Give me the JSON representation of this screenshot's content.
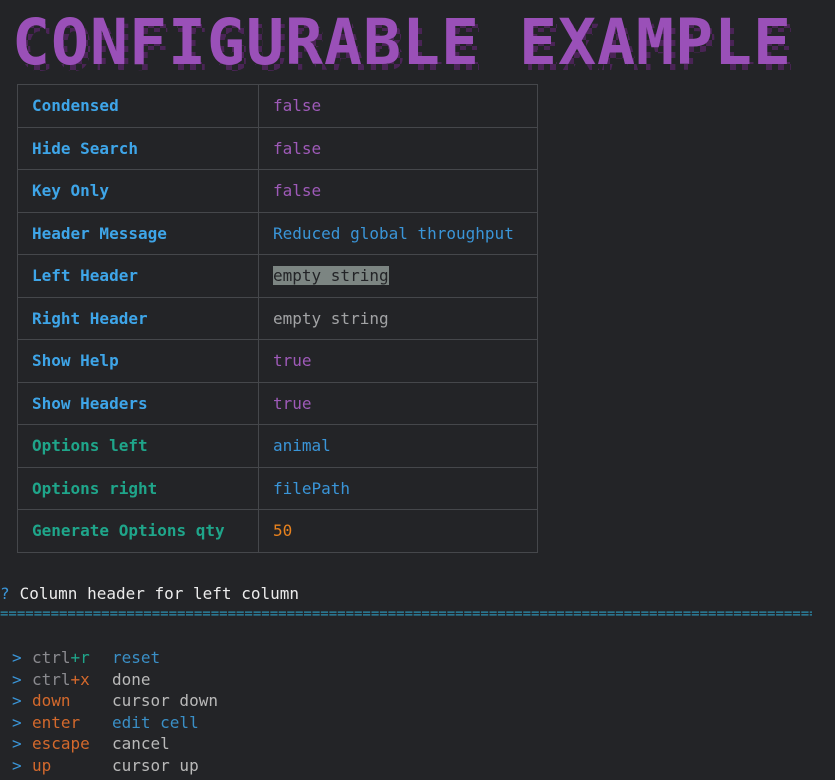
{
  "banner": {
    "title": "CONFIGURABLE EXAMPLE",
    "color": "#9a50b8",
    "shadow_color": "#53285f"
  },
  "config": {
    "rows": [
      {
        "key": "Condensed",
        "value": "false",
        "key_style": "key-blue",
        "value_style": "v-purple"
      },
      {
        "key": "Hide Search",
        "value": "false",
        "key_style": "key-blue",
        "value_style": "v-purple"
      },
      {
        "key": "Key Only",
        "value": "false",
        "key_style": "key-blue",
        "value_style": "v-purple"
      },
      {
        "key": "Header Message",
        "value": "Reduced global throughput",
        "key_style": "key-blue",
        "value_style": "v-blue"
      },
      {
        "key": "Left Header",
        "value": "empty string",
        "key_style": "key-blue",
        "value_style": "v-gray",
        "selected": true
      },
      {
        "key": "Right Header",
        "value": "empty string",
        "key_style": "key-blue",
        "value_style": "v-gray"
      },
      {
        "key": "Show Help",
        "value": "true",
        "key_style": "key-blue",
        "value_style": "v-purple"
      },
      {
        "key": "Show Headers",
        "value": "true",
        "key_style": "key-blue",
        "value_style": "v-purple"
      },
      {
        "key": "Options left",
        "value": "animal",
        "key_style": "key-green",
        "value_style": "v-blue"
      },
      {
        "key": "Options right",
        "value": "filePath",
        "key_style": "key-green",
        "value_style": "v-blue"
      },
      {
        "key": "Generate Options qty",
        "value": "50",
        "key_style": "key-green",
        "value_style": "v-orange"
      }
    ]
  },
  "prompt": {
    "marker": "?",
    "text": "Column header for left column"
  },
  "help": {
    "arrow": ">",
    "items": [
      {
        "parts": [
          {
            "t": "ctrl",
            "c": "k-gray"
          },
          {
            "t": "+r",
            "c": "k-green"
          }
        ],
        "desc": "reset",
        "desc_style": "d-blue"
      },
      {
        "parts": [
          {
            "t": "ctrl",
            "c": "k-gray"
          },
          {
            "t": "+x",
            "c": "k-orange"
          }
        ],
        "desc": "done",
        "desc_style": "d-gray"
      },
      {
        "parts": [
          {
            "t": "down",
            "c": "k-orange"
          }
        ],
        "desc": "cursor down",
        "desc_style": "d-gray"
      },
      {
        "parts": [
          {
            "t": "enter",
            "c": "k-orange"
          }
        ],
        "desc": "edit cell",
        "desc_style": "d-blue"
      },
      {
        "parts": [
          {
            "t": "escape",
            "c": "k-orange"
          }
        ],
        "desc": "cancel",
        "desc_style": "d-gray"
      },
      {
        "parts": [
          {
            "t": "up",
            "c": "k-orange"
          }
        ],
        "desc": "cursor up",
        "desc_style": "d-gray"
      }
    ]
  }
}
